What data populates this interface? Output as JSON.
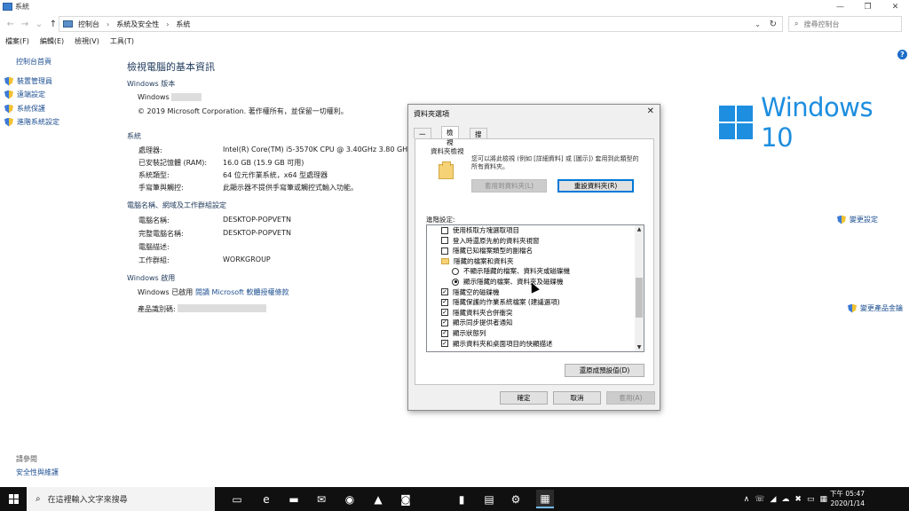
{
  "window": {
    "title": "系統",
    "minimize": "—",
    "maximize": "❐",
    "close": "✕"
  },
  "nav": {
    "back": "←",
    "forward": "→",
    "recent": "⌄",
    "up": "↑",
    "dropdown": "⌄",
    "refresh": "↻"
  },
  "breadcrumb": [
    "控制台",
    "系統及安全性",
    "系統"
  ],
  "breadcrumb_sep": "›",
  "search": {
    "placeholder": "搜尋控制台",
    "icon": "⌕"
  },
  "menu": [
    "檔案(F)",
    "編輯(E)",
    "檢視(V)",
    "工具(T)"
  ],
  "sidebar": {
    "home": "控制台首頁",
    "items": [
      "裝置管理員",
      "遠端設定",
      "系統保護",
      "進階系統設定"
    ],
    "see_also": "請參閱",
    "security_link": "安全性與維護"
  },
  "main": {
    "heading": "檢視電腦的基本資訊",
    "edition_section": "Windows 版本",
    "edition_name": "Windows",
    "copyright": "© 2019 Microsoft Corporation. 著作權所有，並保留一切權利。",
    "system_section": "系統",
    "system_rows": [
      {
        "label": "處理器:",
        "value": "Intel(R) Core(TM) i5-3570K CPU @ 3.40GHz   3.80 GHz"
      },
      {
        "label": "已安裝記憶體 (RAM):",
        "value": "16.0 GB (15.9 GB 可用)"
      },
      {
        "label": "系統類型:",
        "value": "64 位元作業系統，x64 型處理器"
      },
      {
        "label": "手寫筆與觸控:",
        "value": "此顯示器不提供手寫筆或觸控式輸入功能。"
      }
    ],
    "computer_section": "電腦名稱、網域及工作群組設定",
    "computer_rows": [
      {
        "label": "電腦名稱:",
        "value": "DESKTOP-POPVETN"
      },
      {
        "label": "完整電腦名稱:",
        "value": "DESKTOP-POPVETN"
      },
      {
        "label": "電腦描述:",
        "value": ""
      },
      {
        "label": "工作群組:",
        "value": "WORKGROUP"
      }
    ],
    "change_settings": "變更設定",
    "activation_section": "Windows 啟用",
    "activation_status": "Windows 已啟用",
    "license_link": "閱讀 Microsoft 軟體授權條款",
    "product_id_label": "產品識別碼:",
    "change_key": "變更產品金鑰",
    "logo_text": "Windows 10",
    "help": "?"
  },
  "dialog": {
    "title": "資料夾選項",
    "close": "✕",
    "tabs": [
      "一般",
      "檢視",
      "搜尋"
    ],
    "active_tab": 1,
    "views_group": "資料夾檢視",
    "views_desc": "您可以將此檢視 (例如 [詳細資料] 或 [圖示]) 套用到此類型的所有資料夾。",
    "apply_btn": "套用到資料夾(L)",
    "reset_btn": "重設資料夾(R)",
    "advanced_label": "進階設定:",
    "tree_items": [
      {
        "type": "checkbox",
        "checked": false,
        "indent": 0,
        "text": "使用核取方塊選取項目"
      },
      {
        "type": "checkbox",
        "checked": false,
        "indent": 0,
        "text": "登入時還原先前的資料夾視窗"
      },
      {
        "type": "checkbox",
        "checked": false,
        "indent": 0,
        "text": "隱藏已知檔案類型的副檔名"
      },
      {
        "type": "folder",
        "checked": false,
        "indent": 0,
        "text": "隱藏的檔案和資料夾"
      },
      {
        "type": "radio",
        "checked": false,
        "indent": 1,
        "text": "不顯示隱藏的檔案、資料夾或磁碟機"
      },
      {
        "type": "radio",
        "checked": true,
        "indent": 1,
        "text": "顯示隱藏的檔案、資料夾及磁碟機"
      },
      {
        "type": "checkbox",
        "checked": true,
        "indent": 0,
        "text": "隱藏空的磁碟機"
      },
      {
        "type": "checkbox",
        "checked": true,
        "indent": 0,
        "text": "隱藏保護的作業系統檔案 (建議選項)"
      },
      {
        "type": "checkbox",
        "checked": true,
        "indent": 0,
        "text": "隱藏資料夾合併衝突"
      },
      {
        "type": "checkbox",
        "checked": true,
        "indent": 0,
        "text": "顯示同步提供者通知"
      },
      {
        "type": "checkbox",
        "checked": true,
        "indent": 0,
        "text": "顯示狀態列"
      },
      {
        "type": "checkbox",
        "checked": true,
        "indent": 0,
        "text": "顯示資料夾和桌面項目的快顯描述"
      }
    ],
    "check_mark": "✓",
    "scroll_up": "▲",
    "scroll_down": "▼",
    "restore_btn": "還原成預設值(D)",
    "ok_btn": "確定",
    "cancel_btn": "取消",
    "apply_main_btn": "套用(A)"
  },
  "taskbar": {
    "search_placeholder": "在這裡輸入文字來搜尋",
    "search_icon": "⌕",
    "apps": [
      "task-view-icon",
      "edge-icon",
      "file-explorer-icon",
      "mail-icon",
      "chrome-icon",
      "app-icon",
      "line-icon",
      "phone-icon",
      "store-icon",
      "settings-icon",
      "control-panel-icon"
    ],
    "app_glyphs": [
      "▭",
      "e",
      "▬",
      "✉",
      "◉",
      "▲",
      "◙",
      "▮",
      "▤",
      "⚙",
      "▦"
    ],
    "tray_glyphs": [
      "∧",
      "☏",
      "◢",
      "☁",
      "✖",
      "▭",
      "▦"
    ],
    "time": "下午 05:47",
    "date": "2020/1/14"
  }
}
